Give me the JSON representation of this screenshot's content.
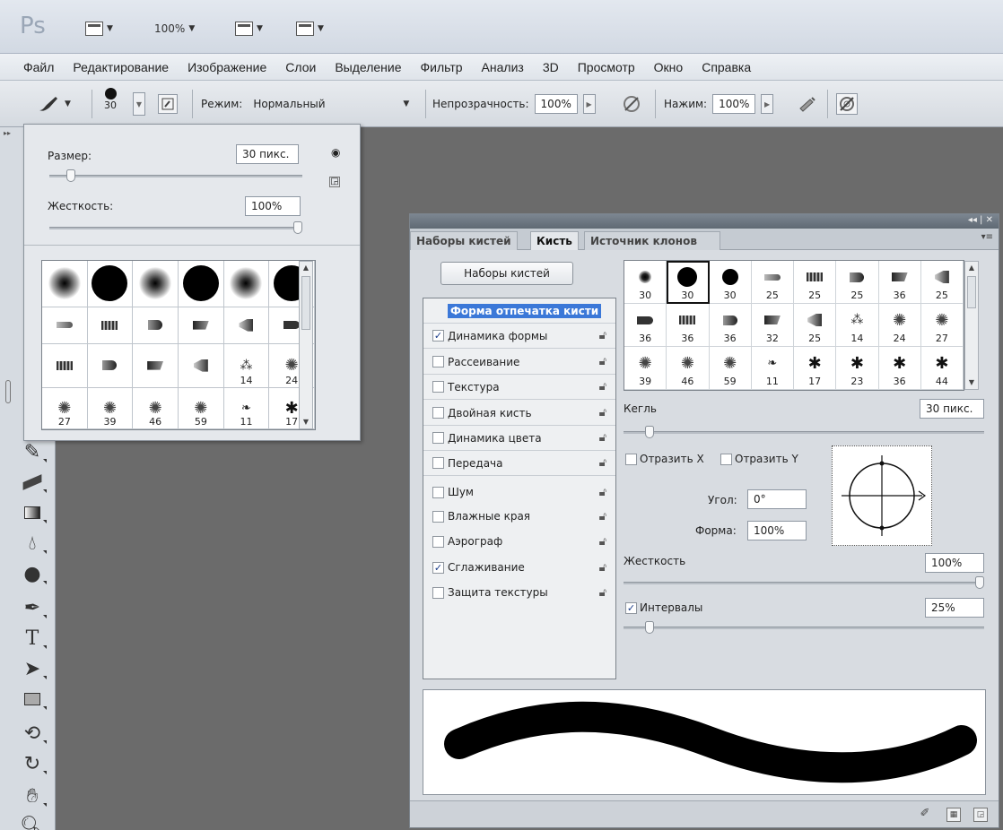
{
  "app": {
    "logo": "Ps",
    "zoom": "100%"
  },
  "menu": [
    "Файл",
    "Редактирование",
    "Изображение",
    "Слои",
    "Выделение",
    "Фильтр",
    "Анализ",
    "3D",
    "Просмотр",
    "Окно",
    "Справка"
  ],
  "options": {
    "brush_size": "30",
    "mode_label": "Режим:",
    "mode_value": "Нормальный",
    "opacity_label": "Непрозрачность:",
    "opacity_value": "100%",
    "flow_label": "Нажим:",
    "flow_value": "100%"
  },
  "picker": {
    "size_label": "Размер:",
    "size_value": "30 пикс.",
    "size_fraction": 0.1,
    "hardness_label": "Жесткость:",
    "hardness_value": "100%",
    "hardness_fraction": 1.0,
    "presets": [
      {
        "kind": "soft",
        "num": ""
      },
      {
        "kind": "hard",
        "num": ""
      },
      {
        "kind": "soft",
        "num": ""
      },
      {
        "kind": "hard",
        "num": ""
      },
      {
        "kind": "soft",
        "num": ""
      },
      {
        "kind": "hard",
        "num": ""
      },
      {
        "kind": "pencil",
        "num": ""
      },
      {
        "kind": "flat",
        "num": ""
      },
      {
        "kind": "round",
        "num": ""
      },
      {
        "kind": "angle",
        "num": ""
      },
      {
        "kind": "fan",
        "num": ""
      },
      {
        "kind": "blunt",
        "num": ""
      },
      {
        "kind": "flat",
        "num": ""
      },
      {
        "kind": "round",
        "num": ""
      },
      {
        "kind": "angle",
        "num": ""
      },
      {
        "kind": "fan",
        "num": ""
      },
      {
        "kind": "spray",
        "num": "14"
      },
      {
        "kind": "scatter",
        "num": "24"
      },
      {
        "kind": "scatter",
        "num": "27"
      },
      {
        "kind": "scatter",
        "num": "39"
      },
      {
        "kind": "scatter",
        "num": "46"
      },
      {
        "kind": "scatter",
        "num": "59"
      },
      {
        "kind": "leaf",
        "num": "11"
      },
      {
        "kind": "grass",
        "num": "17"
      }
    ]
  },
  "panel": {
    "tabs": [
      "Наборы кистей",
      "Кисть",
      "Источник клонов"
    ],
    "presets_button": "Наборы кистей",
    "options": [
      {
        "label": "Форма отпечатка кисти",
        "checked": null,
        "headline": true
      },
      {
        "label": "Динамика формы",
        "checked": true
      },
      {
        "label": "Рассеивание",
        "checked": false
      },
      {
        "label": "Текстура",
        "checked": false
      },
      {
        "label": "Двойная кисть",
        "checked": false
      },
      {
        "label": "Динамика цвета",
        "checked": false
      },
      {
        "label": "Передача",
        "checked": false
      },
      {
        "label": "Шум",
        "checked": false
      },
      {
        "label": "Влажные края",
        "checked": false
      },
      {
        "label": "Аэрограф",
        "checked": false
      },
      {
        "label": "Сглаживание",
        "checked": true
      },
      {
        "label": "Защита текстуры",
        "checked": false
      }
    ],
    "brushes": [
      {
        "kind": "soft-small",
        "num": "30"
      },
      {
        "kind": "hard",
        "num": "30",
        "selected": true
      },
      {
        "kind": "hard-small",
        "num": "30"
      },
      {
        "kind": "pencil",
        "num": "25"
      },
      {
        "kind": "flat",
        "num": "25"
      },
      {
        "kind": "round",
        "num": "25"
      },
      {
        "kind": "angle",
        "num": "36"
      },
      {
        "kind": "fan",
        "num": "25"
      },
      {
        "kind": "blunt",
        "num": "36"
      },
      {
        "kind": "flat",
        "num": "36"
      },
      {
        "kind": "round",
        "num": "36"
      },
      {
        "kind": "angle",
        "num": "32"
      },
      {
        "kind": "fan",
        "num": "25"
      },
      {
        "kind": "spray",
        "num": "14"
      },
      {
        "kind": "scatter",
        "num": "24"
      },
      {
        "kind": "scatter",
        "num": "27"
      },
      {
        "kind": "scatter",
        "num": "39"
      },
      {
        "kind": "scatter",
        "num": "46"
      },
      {
        "kind": "scatter",
        "num": "59"
      },
      {
        "kind": "leaf",
        "num": "11"
      },
      {
        "kind": "grass",
        "num": "17"
      },
      {
        "kind": "grass",
        "num": "23"
      },
      {
        "kind": "grass",
        "num": "36"
      },
      {
        "kind": "grass",
        "num": "44"
      }
    ],
    "size_label": "Кегль",
    "size_value": "30 пикс.",
    "size_fraction": 0.1,
    "flip_x": "Отразить X",
    "flip_y": "Отразить Y",
    "angle_label": "Угол:",
    "angle_value": "0°",
    "roundness_label": "Форма:",
    "roundness_value": "100%",
    "hardness_label": "Жесткость",
    "hardness_value": "100%",
    "hardness_fraction": 1.0,
    "spacing_label": "Интервалы",
    "spacing_checked": true,
    "spacing_value": "25%",
    "spacing_fraction": 0.1
  }
}
